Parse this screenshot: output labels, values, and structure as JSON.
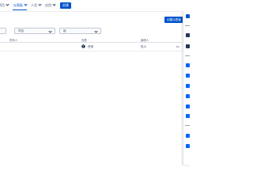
{
  "nav": {
    "items": [
      {
        "label": "项目"
      },
      {
        "label": "仪表板",
        "active": true
      },
      {
        "label": "人员"
      },
      {
        "label": "应用"
      }
    ],
    "create_label": "创建"
  },
  "header": {
    "primary_button": "创建仪表板"
  },
  "filters": [
    {
      "label": ""
    },
    {
      "label": "项目"
    },
    {
      "label": "组"
    }
  ],
  "table": {
    "columns": [
      "",
      "所有人",
      "",
      "查看",
      "编辑人",
      ""
    ],
    "rows": [
      {
        "name": "",
        "owner": "",
        "view": "任何",
        "editor": "仅人"
      }
    ]
  },
  "right_panel": {
    "icons": [
      "panel-header-icon",
      "dark-app-icon",
      "dark-app-icon",
      "blue-app-icon",
      "blue-app-icon",
      "blue-app-icon",
      "blue-app-icon",
      "blue-app-icon",
      "blue-app-icon",
      "blue-app-icon",
      "blue-app-icon"
    ]
  },
  "colors": {
    "accent": "#0052cc",
    "text": "#172b4d",
    "muted": "#5e6c84",
    "border": "#dfe1e6"
  }
}
